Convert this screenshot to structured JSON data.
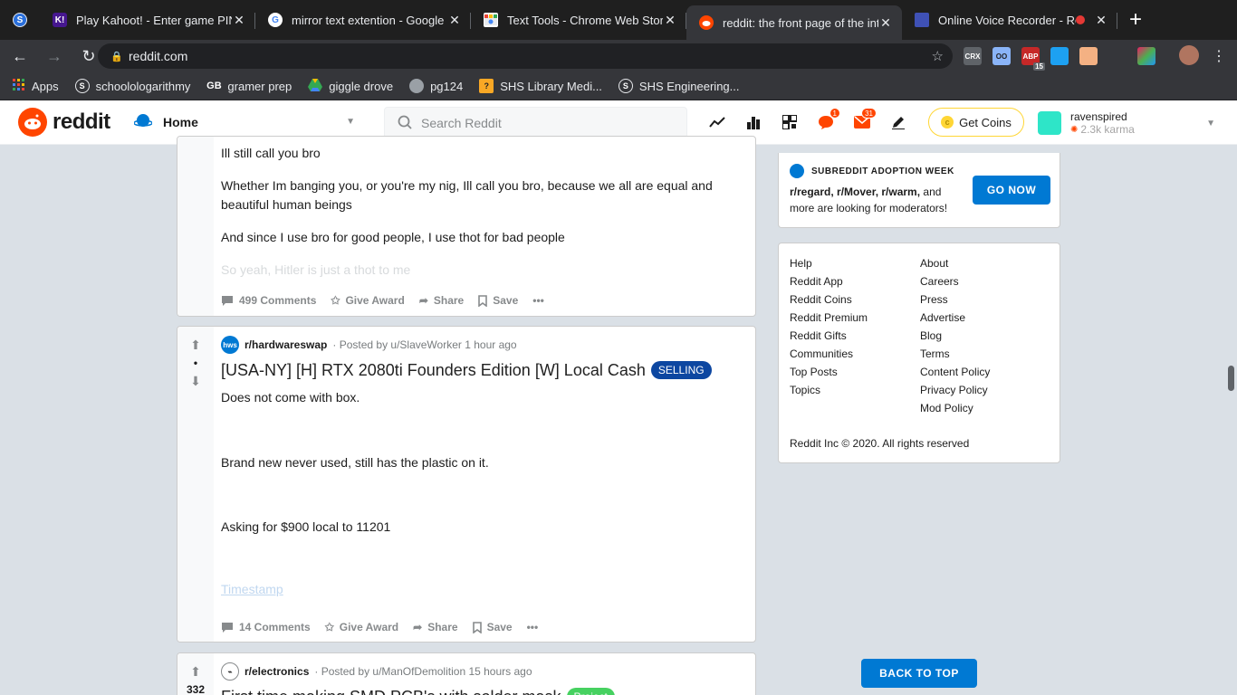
{
  "browser": {
    "tabs": [
      {
        "title": "Play Kahoot! - Enter game PIN",
        "favicon_text": "K!",
        "favicon_color": "#46178f",
        "active": false
      },
      {
        "title": "mirror text extention - Google Search",
        "favicon_text": "G",
        "favicon_color": "#ffffff",
        "active": false
      },
      {
        "title": "Text Tools - Chrome Web Store",
        "favicon_text": "",
        "favicon_color": "#e74c3c",
        "active": false
      },
      {
        "title": "reddit: the front page of the internet",
        "favicon_text": "",
        "favicon_color": "#ff4500",
        "active": true
      },
      {
        "title": "Online Voice Recorder - Record",
        "favicon_text": "",
        "favicon_color": "#3f51b5",
        "active": false
      }
    ],
    "url": "reddit.com",
    "bookmarks": [
      {
        "label": "Apps",
        "icon": "apps-grid-icon"
      },
      {
        "label": "schoolologarithmy",
        "icon": "schoology-icon"
      },
      {
        "label": "gramer prep",
        "icon": "gb-icon"
      },
      {
        "label": "giggle drove",
        "icon": "drive-icon"
      },
      {
        "label": "pg124",
        "icon": "globe-icon"
      },
      {
        "label": "SHS Library Medi...",
        "icon": "library-icon"
      },
      {
        "label": "SHS Engineering...",
        "icon": "schoology-icon"
      }
    ],
    "extensions": [
      "CRX",
      "OO",
      "ABP",
      "",
      "",
      "",
      ""
    ],
    "abp_count": "15"
  },
  "reddit": {
    "logo": "reddit",
    "home_label": "Home",
    "search_placeholder": "Search Reddit",
    "chat_badge": "1",
    "mail_badge": "31",
    "get_coins": "Get Coins",
    "username": "ravenspired",
    "karma": "2.3k karma"
  },
  "posts": [
    {
      "paragraphs": [
        "Ill still call you bro",
        "Whether Im banging you, or you're my nig, Ill call you bro, because we all are equal and beautiful human beings",
        "And since I use bro for good people, I use thot for bad people",
        "So yeah, Hitler is just a thot to me"
      ],
      "comments": "499 Comments",
      "give_award": "Give Award",
      "share": "Share",
      "save": "Save"
    },
    {
      "score": "•",
      "subreddit": "r/hardwareswap",
      "posted_by": "· Posted by u/SlaveWorker 1 hour ago",
      "title": "[USA-NY] [H] RTX 2080ti Founders Edition [W] Local Cash",
      "flair": "SELLING",
      "paragraphs": [
        "Does not come with box.",
        "Brand new never used, still has the plastic on it.",
        "Asking for $900 local to 11201"
      ],
      "link": "Timestamp",
      "comments": "14 Comments",
      "give_award": "Give Award",
      "share": "Share",
      "save": "Save"
    },
    {
      "score": "332",
      "subreddit": "r/electronics",
      "posted_by": "· Posted by u/ManOfDemolition 15 hours ago",
      "title": "First time making SMD PCB's with solder mask",
      "flair": "Project"
    }
  ],
  "sidebar": {
    "adoption_title": "SUBREDDIT ADOPTION WEEK",
    "adoption_subs": "r/regard, r/Mover, r/warm,",
    "adoption_rest": " and more are looking for moderators!",
    "go_now": "GO NOW",
    "links_left": [
      "Help",
      "Reddit App",
      "Reddit Coins",
      "Reddit Premium",
      "Reddit Gifts",
      "Communities",
      "Top Posts",
      "Topics"
    ],
    "links_right": [
      "About",
      "Careers",
      "Press",
      "Advertise",
      "Blog",
      "Terms",
      "Content Policy",
      "Privacy Policy",
      "Mod Policy"
    ],
    "copyright": "Reddit Inc © 2020. All rights reserved",
    "back_to_top": "BACK TO TOP"
  }
}
